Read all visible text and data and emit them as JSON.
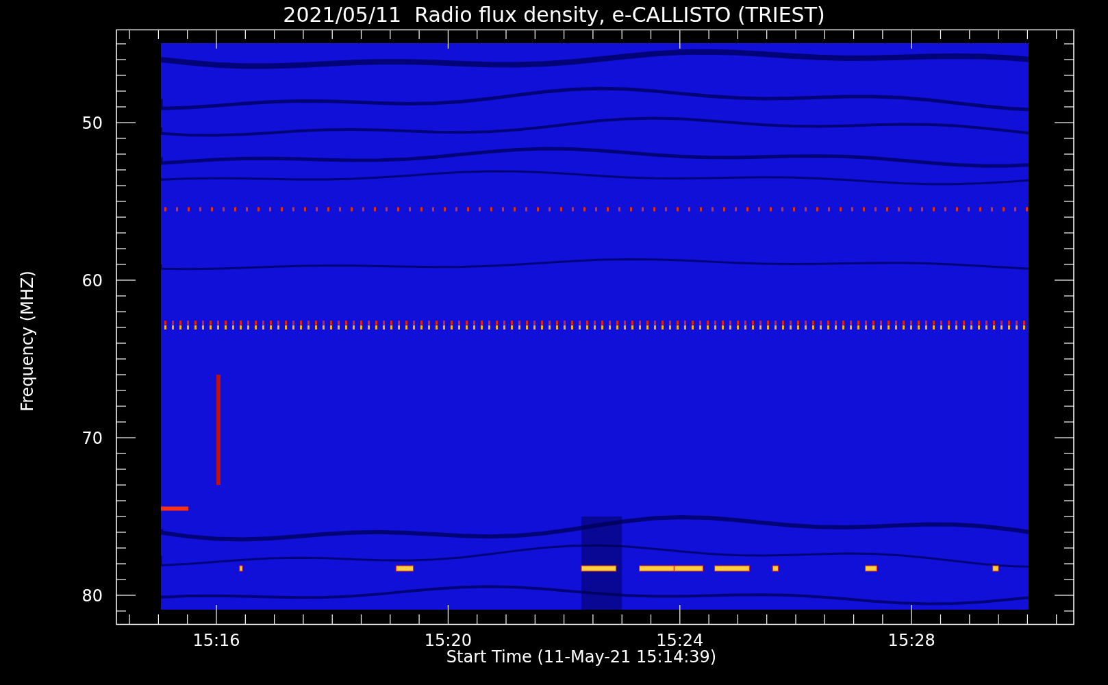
{
  "title": "2021/05/11  Radio flux density, e-CALLISTO (TRIEST)",
  "y_axis": {
    "title": "Frequency (MHZ)",
    "tick_labels": [
      "50",
      "60",
      "70",
      "80"
    ]
  },
  "x_axis": {
    "title": "Start Time (11-May-21 15:14:39)",
    "tick_labels": [
      "15:16",
      "15:20",
      "15:24",
      "15:28"
    ]
  }
}
